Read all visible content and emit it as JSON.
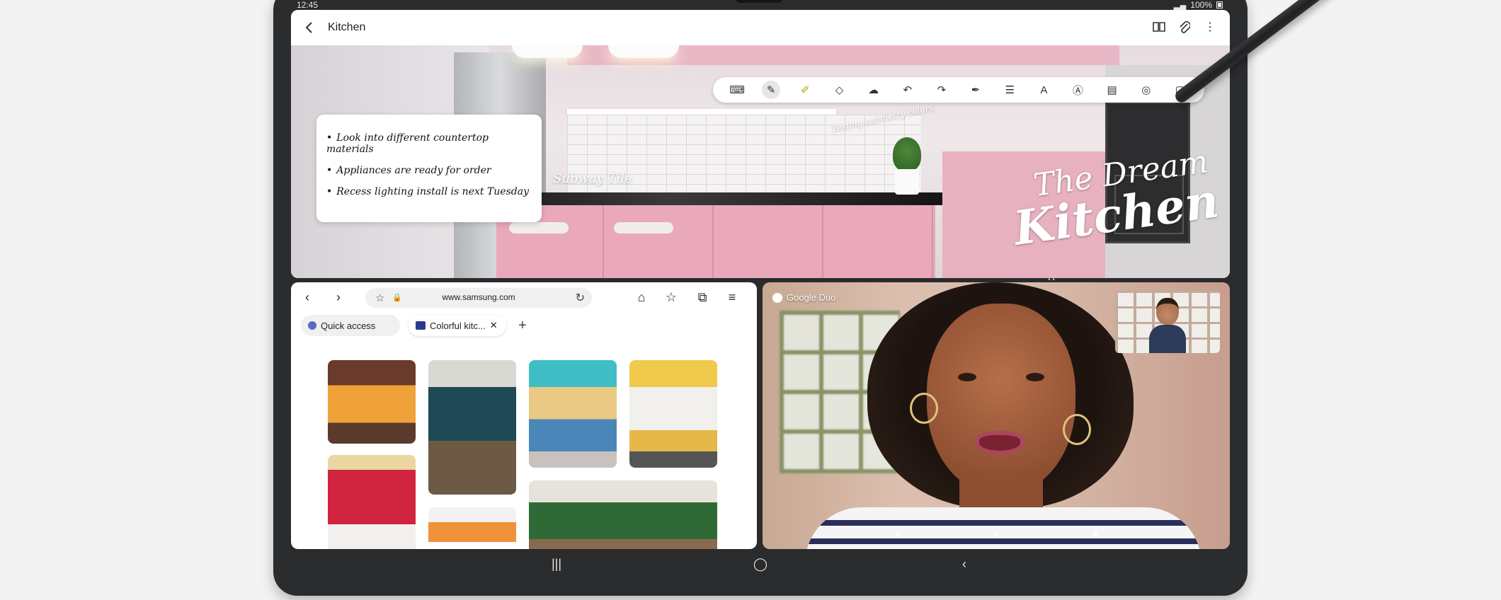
{
  "status_bar": {
    "time": "12:45",
    "battery": "100%"
  },
  "notes": {
    "title": "Kitchen",
    "checklist": [
      "Look into different countertop materials",
      "Appliances are ready for order",
      "Recess lighting install is next Tuesday"
    ],
    "handwriting": {
      "subway": "Subway Tile",
      "testing": "Testing cabinetry colors",
      "dream": "The Dream",
      "kitchen": "Kitchen"
    },
    "toolbar_icons": [
      "keyboard-icon",
      "pen-icon",
      "highlighter-icon",
      "eraser-icon",
      "lasso-icon",
      "undo-icon",
      "redo-icon",
      "pen-settings-icon",
      "align-icon",
      "text-style-icon",
      "handwriting-icon",
      "insert-icon",
      "shapes-icon",
      "pdf-icon"
    ]
  },
  "browser": {
    "url": "www.samsung.com",
    "tabs": [
      {
        "label": "Quick access"
      },
      {
        "label": "Colorful kitc..."
      }
    ],
    "new_tab": "+"
  },
  "video_call": {
    "app_label": "Google Duo"
  },
  "colors": {
    "accent": "#2f87c6",
    "device": "#2b2c2e",
    "pink": "#e9b1c0"
  }
}
